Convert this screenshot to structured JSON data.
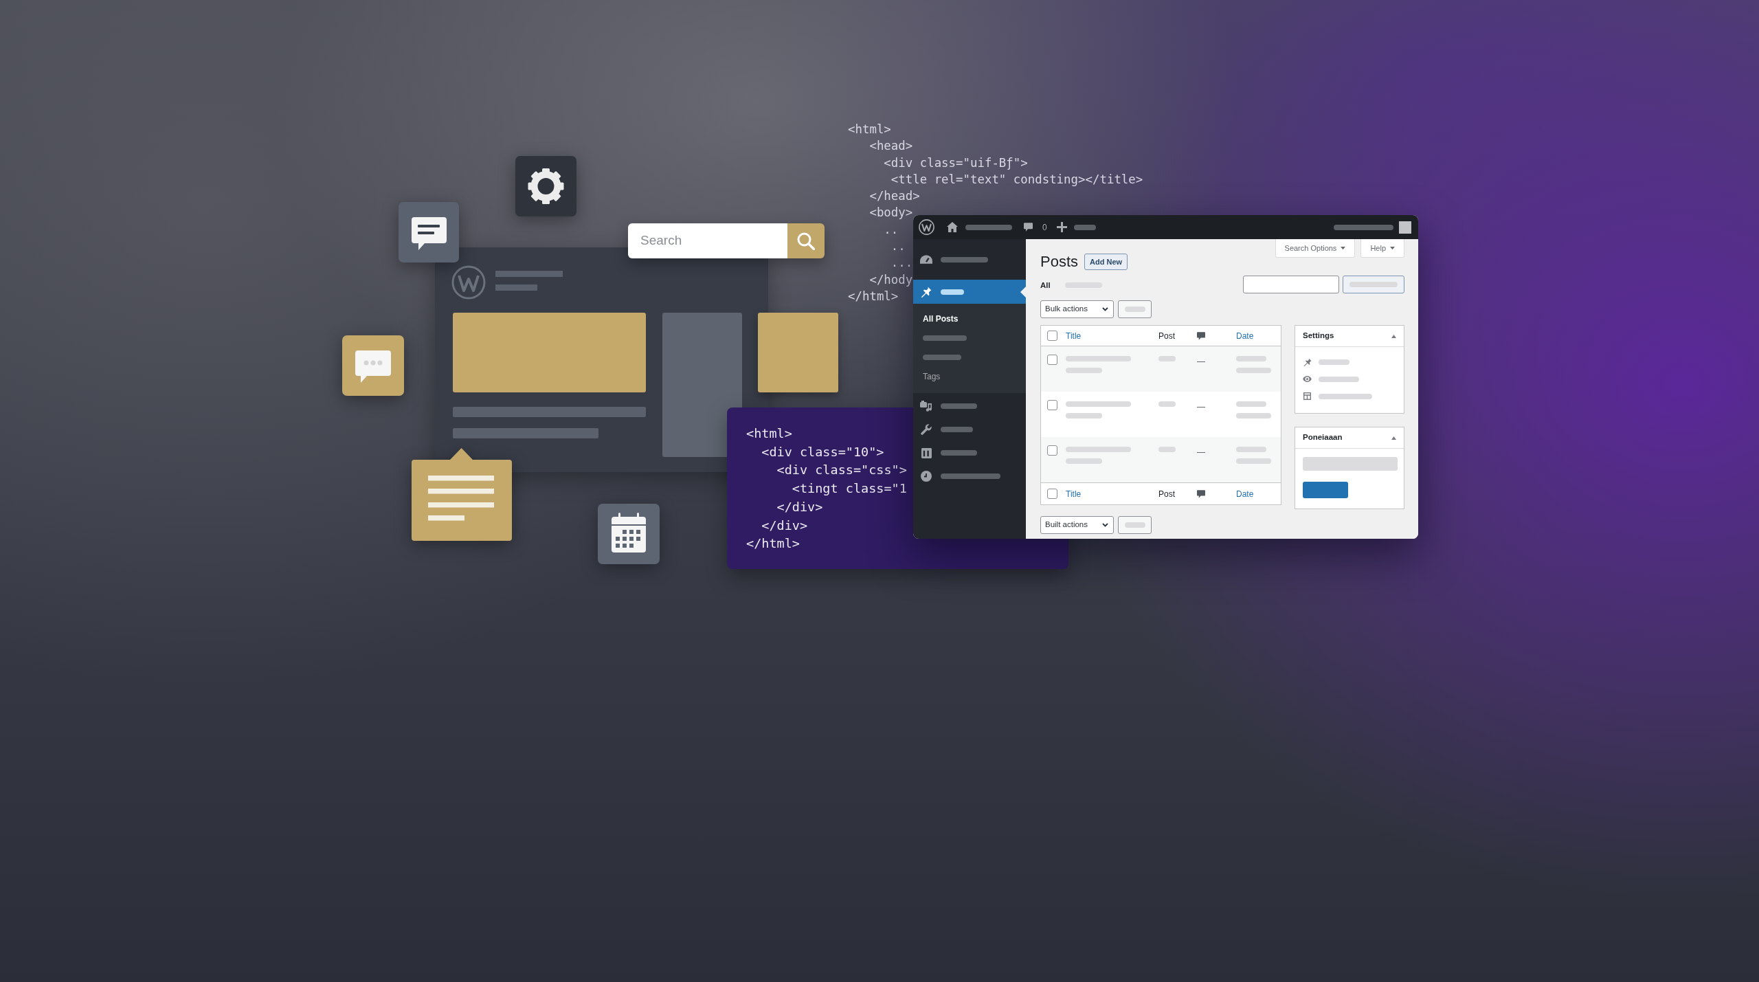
{
  "search": {
    "placeholder": "Search"
  },
  "code_top": {
    "lines": [
      "<html>",
      "   <head>",
      "     <div class=\"uif-Bƒ\">",
      "      <ttle rel=\"text\" condsting></title>",
      "   </head>",
      "   <body>",
      "     ..",
      "      ..",
      "      ...",
      "   </hody",
      "</html>"
    ]
  },
  "code_panel": {
    "lines": [
      "<html>",
      "  <div class=\"10\">",
      "    <div class=\"css\">",
      "      <tingt class=\"1",
      "    </div>",
      "  </div>",
      "</html>"
    ]
  },
  "admin": {
    "toolbar": {
      "comment_count": "0"
    },
    "menu": [
      {
        "selected": false
      },
      {
        "selected": true,
        "children": [
          {
            "label": "All Posts",
            "selected": true
          },
          {
            "selected": false
          },
          {
            "selected": false
          },
          {
            "label": "Tags",
            "selected": false
          }
        ]
      },
      {
        "selected": false
      },
      {
        "selected": false
      },
      {
        "selected": false
      },
      {
        "selected": false
      }
    ],
    "screen_tabs": [
      "Search Options",
      "Help"
    ],
    "title": "Posts",
    "add_new": "Add New",
    "filters": [
      {
        "label": "All",
        "selected": true
      },
      {
        "selected": false
      }
    ],
    "bulk_actions_top": "Bulk actions",
    "table": {
      "header": {
        "checked": false,
        "columns": [
          {
            "kind": "text",
            "label": "Title",
            "sortable": true
          },
          {
            "kind": "text",
            "label": "Post",
            "sortable": false
          },
          {
            "kind": "icon"
          },
          {
            "kind": "text",
            "label": "Date",
            "sortable": true
          }
        ]
      },
      "rows": [
        {
          "checked": false,
          "comments": "—"
        },
        {
          "checked": false,
          "comments": "—"
        },
        {
          "checked": false,
          "comments": "—"
        }
      ],
      "footer": {
        "checked": false,
        "columns": [
          {
            "kind": "text",
            "label": "Title",
            "sortable": true
          },
          {
            "kind": "text",
            "label": "Post",
            "sortable": false
          },
          {
            "kind": "icon"
          },
          {
            "kind": "text",
            "label": "Date",
            "sortable": true
          }
        ]
      }
    },
    "bulk_actions_bottom": "Built actions",
    "boxes": [
      {
        "kind": "list",
        "title": "Settings",
        "expanded": true
      },
      {
        "kind": "form",
        "title": "Poneiaaan",
        "expanded": true
      }
    ]
  }
}
